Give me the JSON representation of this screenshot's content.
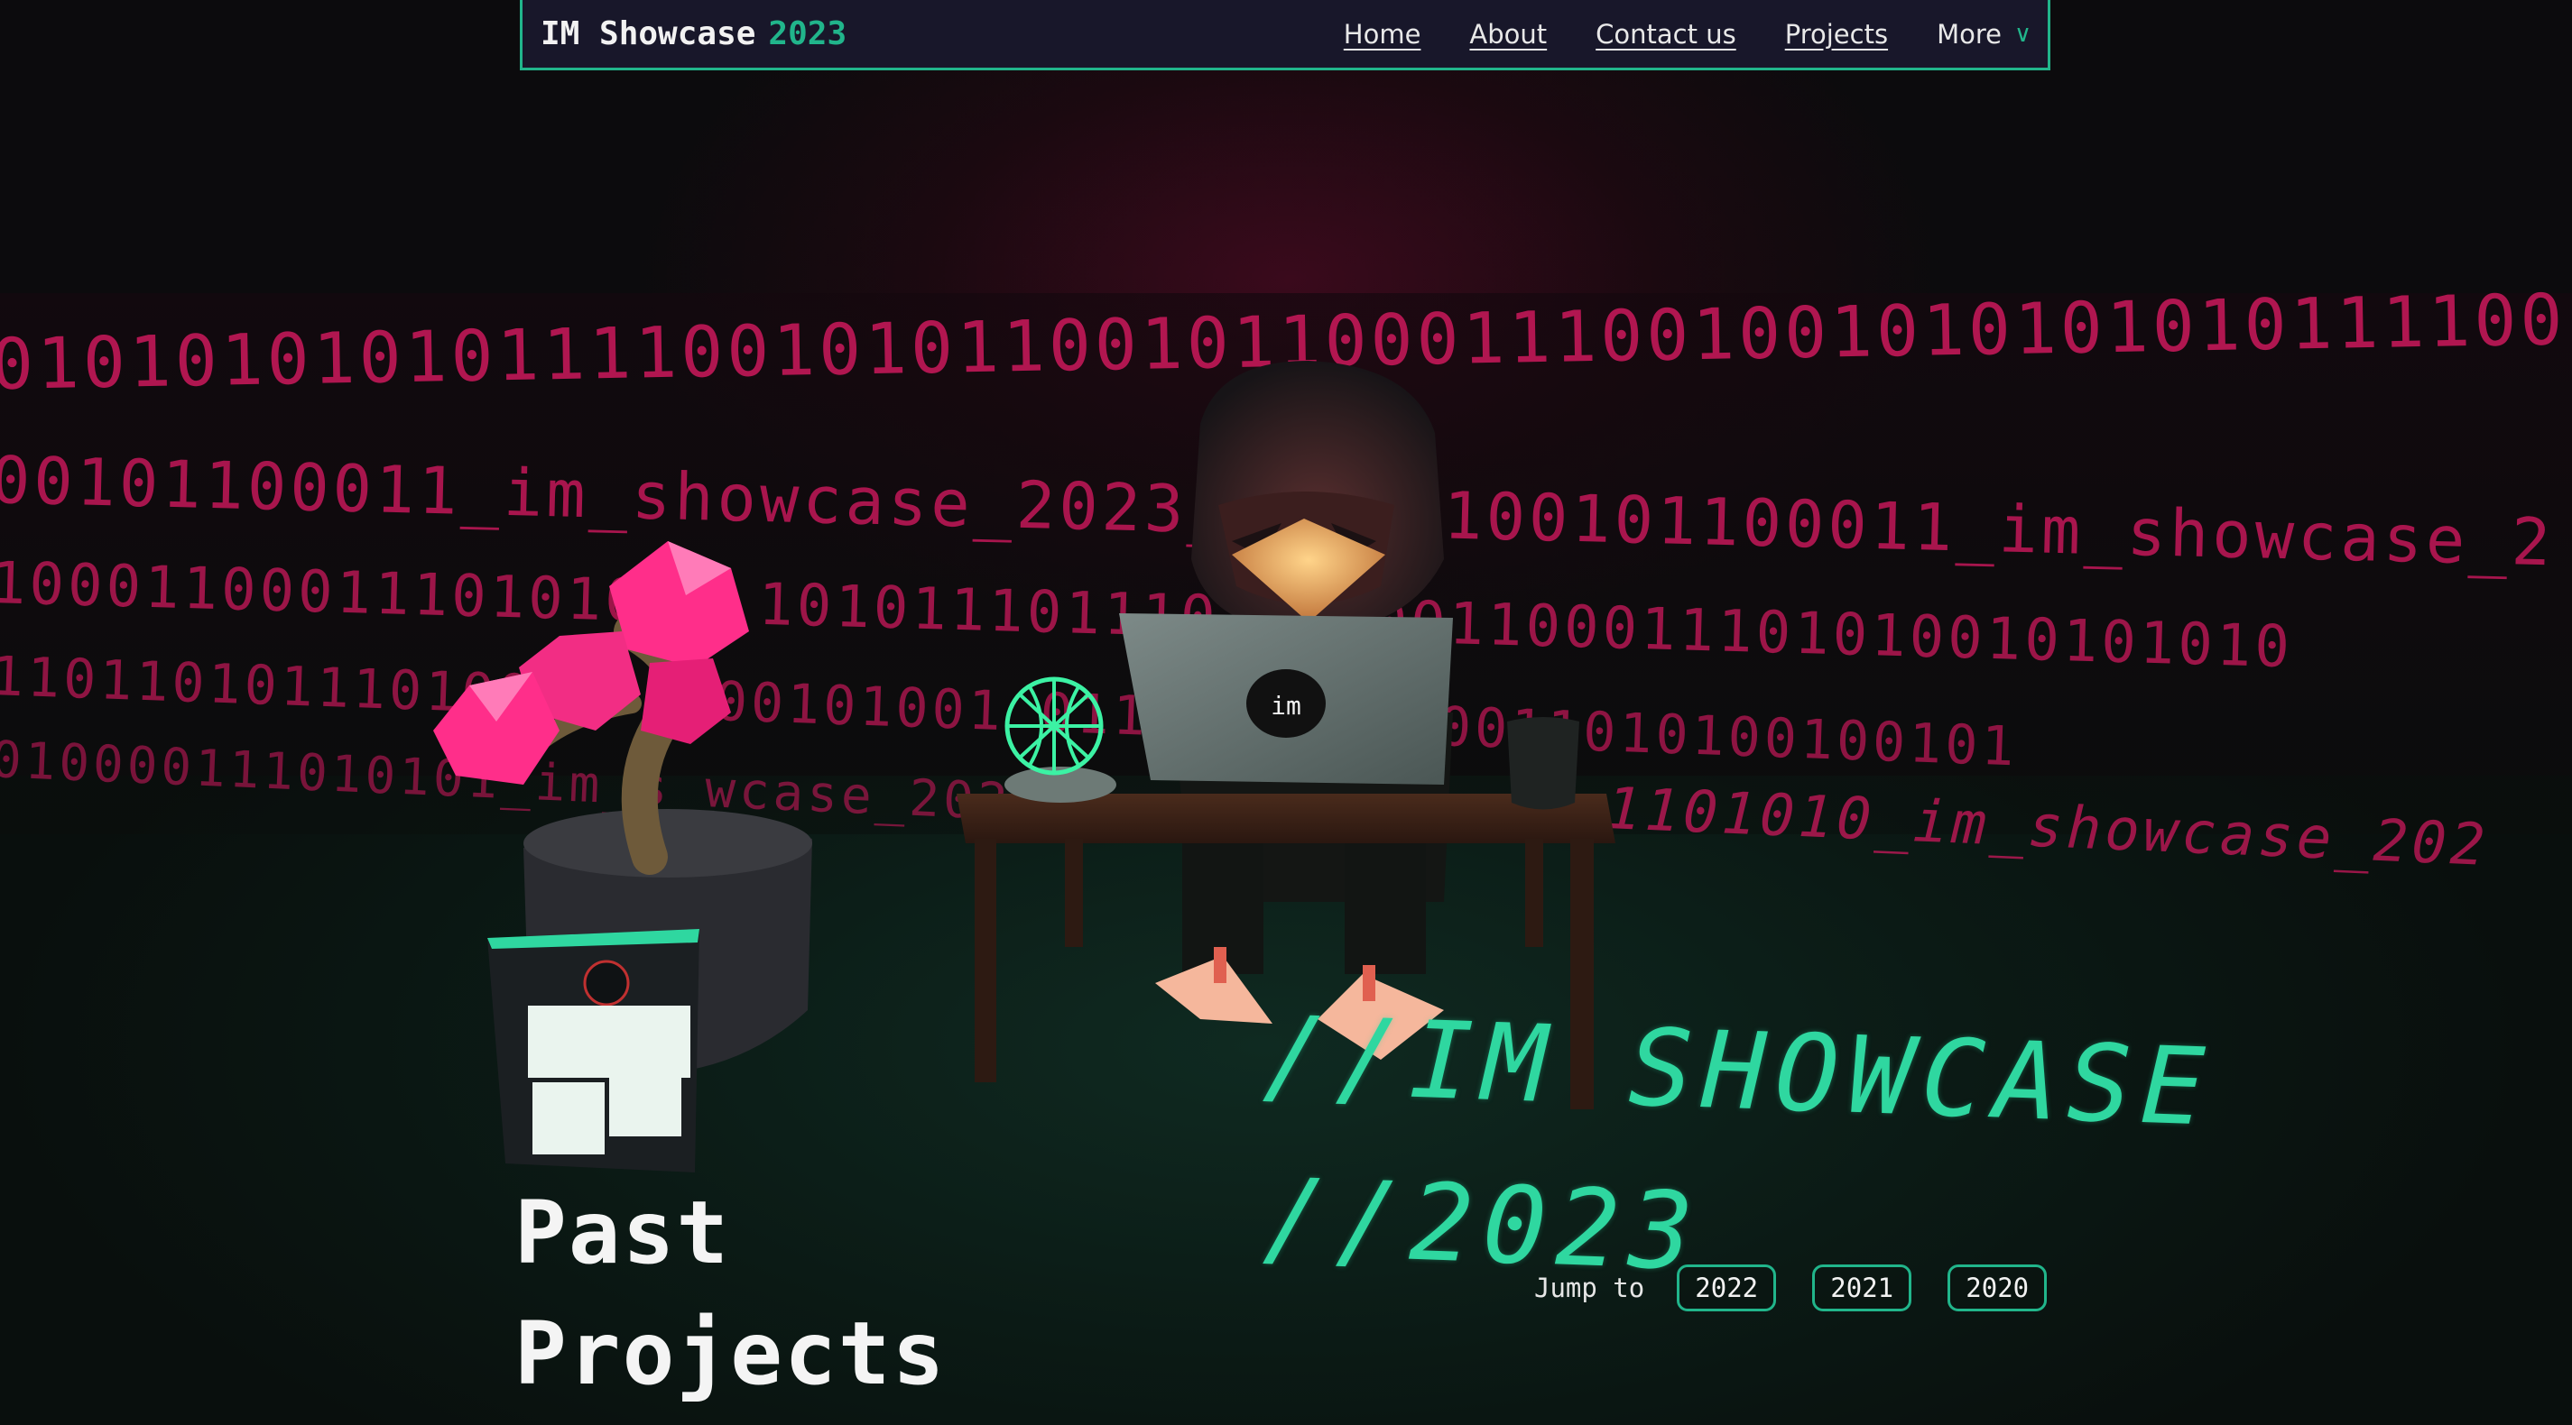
{
  "navbar": {
    "brand_name": "IM Showcase",
    "brand_year": "2023",
    "links": [
      "Home",
      "About",
      "Contact us",
      "Projects"
    ],
    "more_label": "More",
    "more_icon": "chevron-down-icon"
  },
  "background": {
    "binary_lines": [
      "0101010101011110010101100101100011100100101010101011110010101100101",
      "00101100011_im_showcase_2023_110                    1100101100011_im_showcase_2",
      "1000110001110101001              1010111011101    10001100011101010010101010",
      "11011010111010011             0100101001       011010111010011010100100101",
      "010000111010101_im_s  wcase_202",
      "1101010_im_showcase_202"
    ],
    "laptop_sticker": "im"
  },
  "hero": {
    "title_line1": "//IM SHOWCASE",
    "title_line2": "//2023"
  },
  "jump": {
    "label": "Jump to",
    "years": [
      "2022",
      "2021",
      "2020"
    ]
  },
  "section": {
    "title_line1": "Past",
    "title_line2": "Projects"
  },
  "colors": {
    "accent": "#21b58b",
    "binary": "#d3195f",
    "nav_bg": "#18172a",
    "crystal": "#ff2e8a"
  }
}
